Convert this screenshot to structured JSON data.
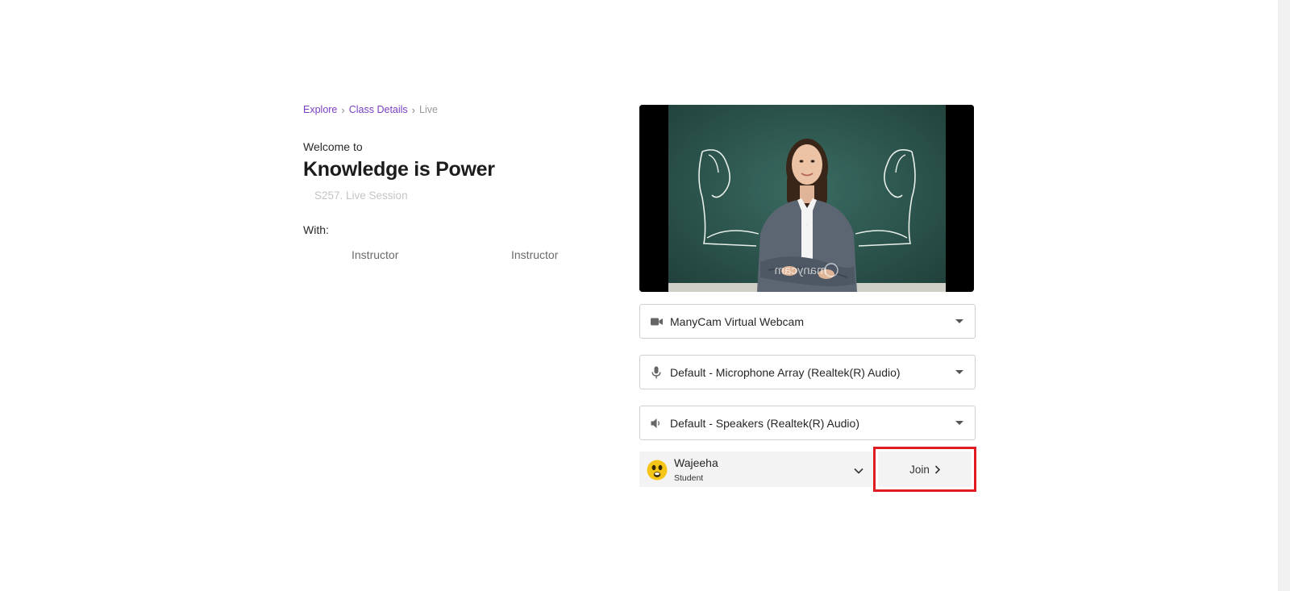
{
  "breadcrumb": {
    "explore": "Explore",
    "class_details": "Class Details",
    "current": "Live",
    "separator": "›"
  },
  "header": {
    "welcome": "Welcome to",
    "title": "Knowledge is Power",
    "session": "S257. Live Session"
  },
  "with_label": "With:",
  "instructors": [
    "Instructor",
    "Instructor"
  ],
  "video": {
    "watermark": "manycam"
  },
  "devices": {
    "camera": {
      "icon": "video-camera-icon",
      "value": "ManyCam Virtual Webcam"
    },
    "microphone": {
      "icon": "microphone-icon",
      "value": "Default - Microphone Array (Realtek(R) Audio)"
    },
    "speaker": {
      "icon": "speaker-icon",
      "value": "Default - Speakers (Realtek(R) Audio)"
    }
  },
  "user": {
    "name": "Wajeeha",
    "role": "Student",
    "avatar_icon": "smiley-face-icon"
  },
  "join": {
    "label": "Join",
    "icon": "chevron-right-icon"
  },
  "colors": {
    "link": "#7b3fc4",
    "highlight": "#e01b22",
    "chalkboard": "#2f5a52"
  }
}
